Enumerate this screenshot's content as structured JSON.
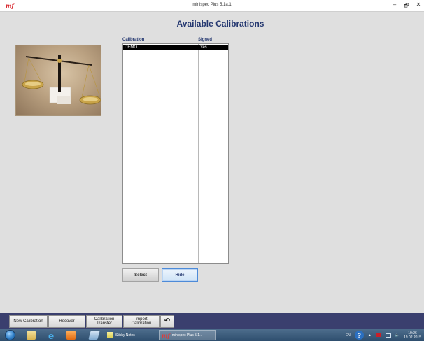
{
  "window": {
    "logo": "mf",
    "title": "minispec Plus 5.1a.1",
    "controls": {
      "minimize": "–",
      "restore": "🗗",
      "close": "✕"
    }
  },
  "page": {
    "heading": "Available Calibrations",
    "image_icon": "balance-scale-photo"
  },
  "table": {
    "columns": [
      "Calibration",
      "Signed"
    ],
    "rows": [
      {
        "calibration": "DEMO",
        "signed": "Yes",
        "selected": true
      }
    ]
  },
  "buttons": {
    "select": "Select",
    "hide": "Hide"
  },
  "toolbar": {
    "new_calibration": "New Calibration",
    "recover": "Recover",
    "calibration_transfer_1": "Calibration",
    "calibration_transfer_2": "Transfer",
    "import_calibration_1": "Import",
    "import_calibration_2": "Calibration",
    "undo": "↶"
  },
  "taskbar": {
    "tasks": [
      {
        "label": "Sticky Notes",
        "icon": "sticky-notes-icon"
      },
      {
        "label": "minispec Plus 5.1...",
        "icon": "minispec-icon"
      }
    ],
    "language": "EN",
    "time": "10:26",
    "date": "19.02.2015"
  }
}
